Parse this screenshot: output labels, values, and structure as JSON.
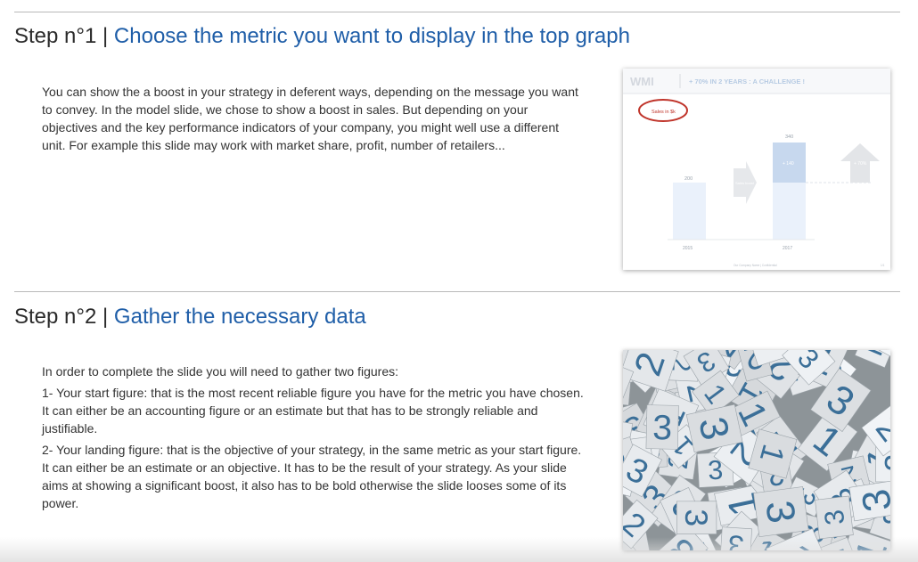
{
  "step1": {
    "prefix": "Step n°1",
    "separator": "|",
    "title": "Choose the metric you want to display in the top graph",
    "paragraphs": [
      "You can show the a boost in your strategy in deferent ways, depending on the message you want to convey. In the model slide, we chose to show a boost in sales. But depending on your objectives and the key performance indicators of your company, you might well use a different unit. For example this slide may work with market share, profit, number of retailers..."
    ],
    "slide": {
      "logo": "WMI",
      "headline": "+ 70% IN 2 YEARS : A CHALLENGE !",
      "circled_label": "Sales in $k",
      "bar_start_value": "200",
      "bar_end_value": "340",
      "increment_label": "+ 140",
      "arrow_label": "Sales boost",
      "big_arrow_label": "+ 70%",
      "year_start": "2015",
      "year_end": "2017",
      "footer": "Our Company Name | Confidential",
      "page": "1/1"
    }
  },
  "step2": {
    "prefix": "Step n°2",
    "separator": "|",
    "title": "Gather the necessary data",
    "paragraphs": [
      "In order to complete the slide you will need to gather two figures:",
      "1- Your start figure: that is the most recent reliable figure you have for the metric you have chosen. It can either be an accounting figure or an estimate but that has to be strongly reliable and justifiable.",
      "2- Your landing figure: that is the objective of your strategy, in the same metric as your start figure. It can either be an estimate or an objective. It has to be the result of your strategy. As your slide aims at showing a significant boost, it also has to be bold otherwise the slide looses some of its power."
    ],
    "photo_digits": [
      "1",
      "2",
      "3"
    ]
  }
}
